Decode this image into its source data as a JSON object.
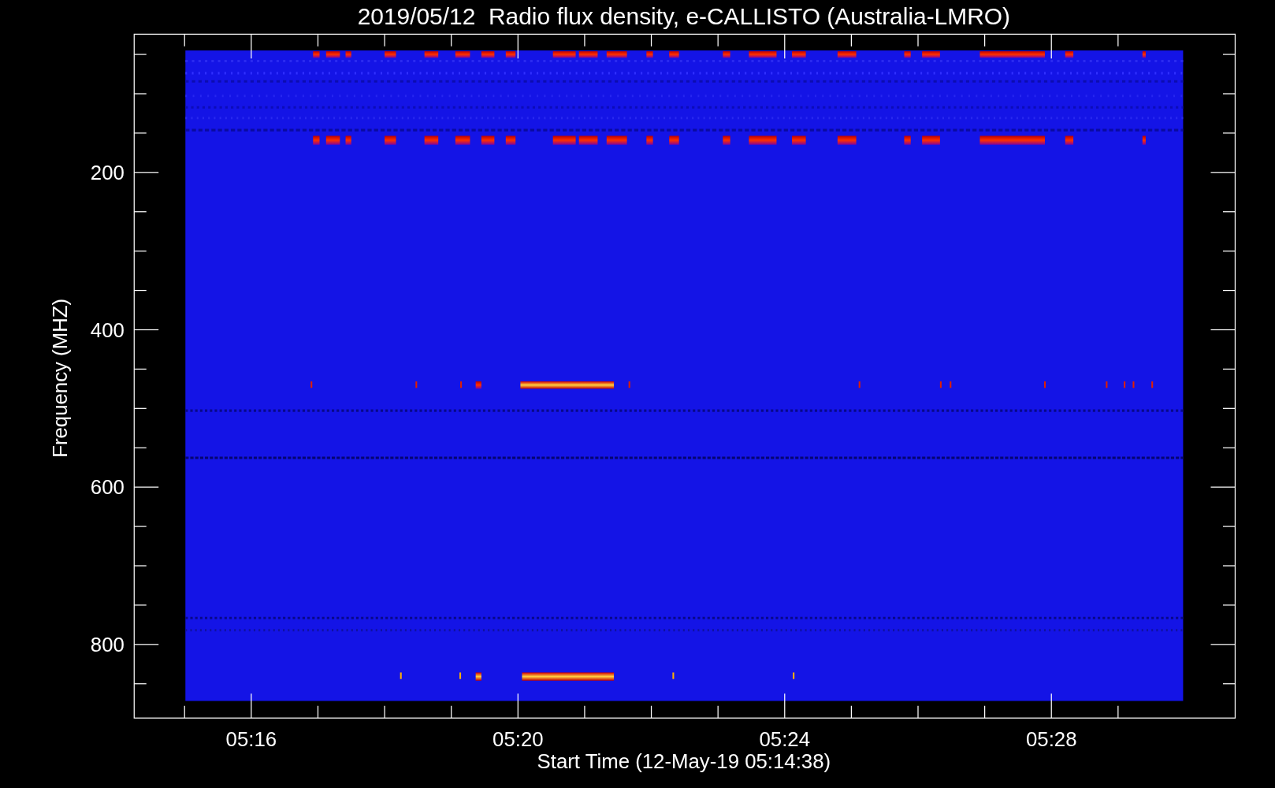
{
  "title": "2019/05/12  Radio flux density, e-CALLISTO (Australia-LMRO)",
  "x_axis": {
    "label": "Start Time (12-May-19 05:14:38)",
    "ticks": [
      "05:16",
      "05:20",
      "05:24",
      "05:28"
    ]
  },
  "y_axis": {
    "label": "Frequency (MHZ)",
    "ticks": [
      "200",
      "400",
      "600",
      "800"
    ]
  }
}
